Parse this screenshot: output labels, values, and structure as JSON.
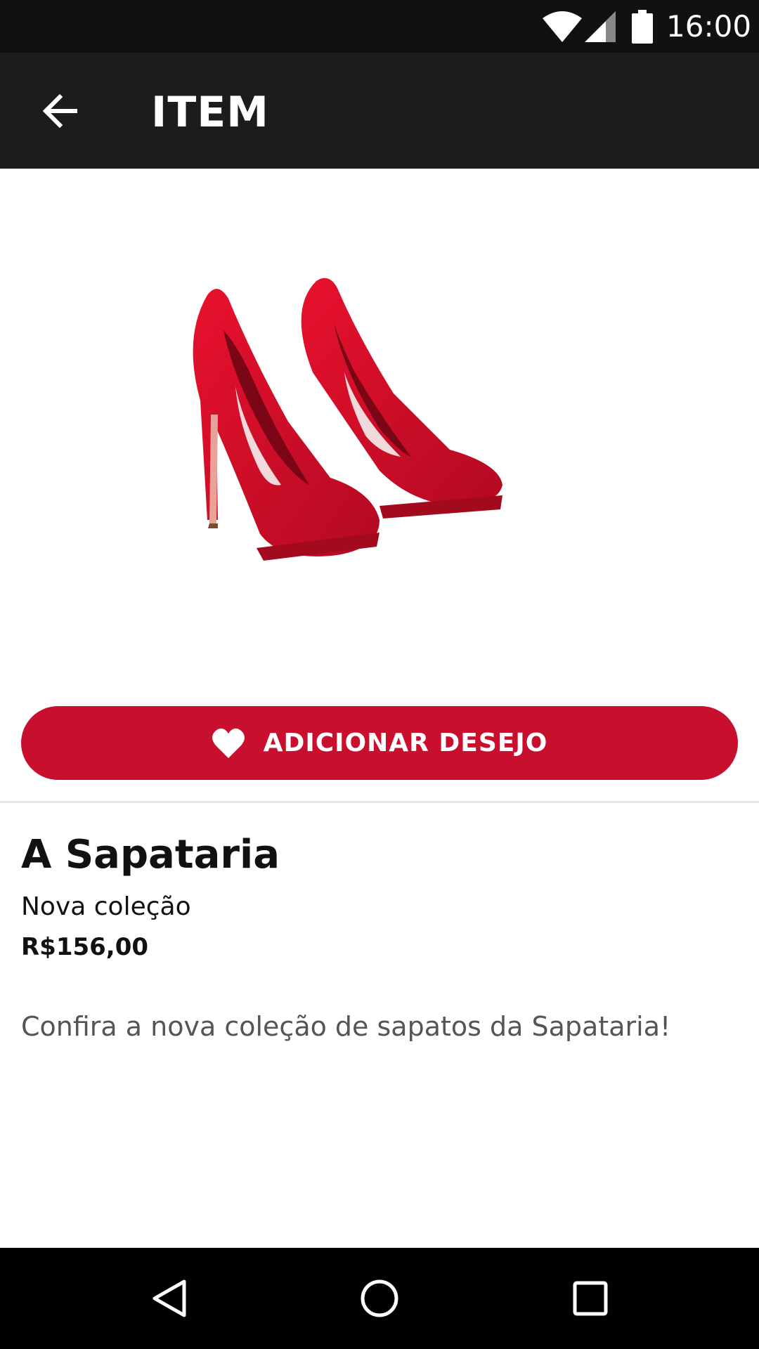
{
  "status_bar": {
    "time": "16:00",
    "icons": [
      "wifi-icon",
      "signal-icon",
      "battery-icon"
    ]
  },
  "app_bar": {
    "title": "ITEM",
    "back_icon": "arrow-left-icon"
  },
  "product": {
    "image": "red-high-heel-shoes",
    "wish_button_label": "ADICIONAR DESEJO",
    "wish_icon": "heart-icon",
    "store_name": "A Sapataria",
    "subtitle": "Nova coleção",
    "price": "R$156,00",
    "description": "Confira a nova coleção de sapatos da Sapataria!"
  },
  "nav_bar": {
    "icons": [
      "nav-back-icon",
      "nav-home-icon",
      "nav-recents-icon"
    ]
  },
  "colors": {
    "accent": "#c8102e",
    "app_bar": "#1c1c1c",
    "status_bar": "#111111",
    "nav_bar": "#000000"
  }
}
